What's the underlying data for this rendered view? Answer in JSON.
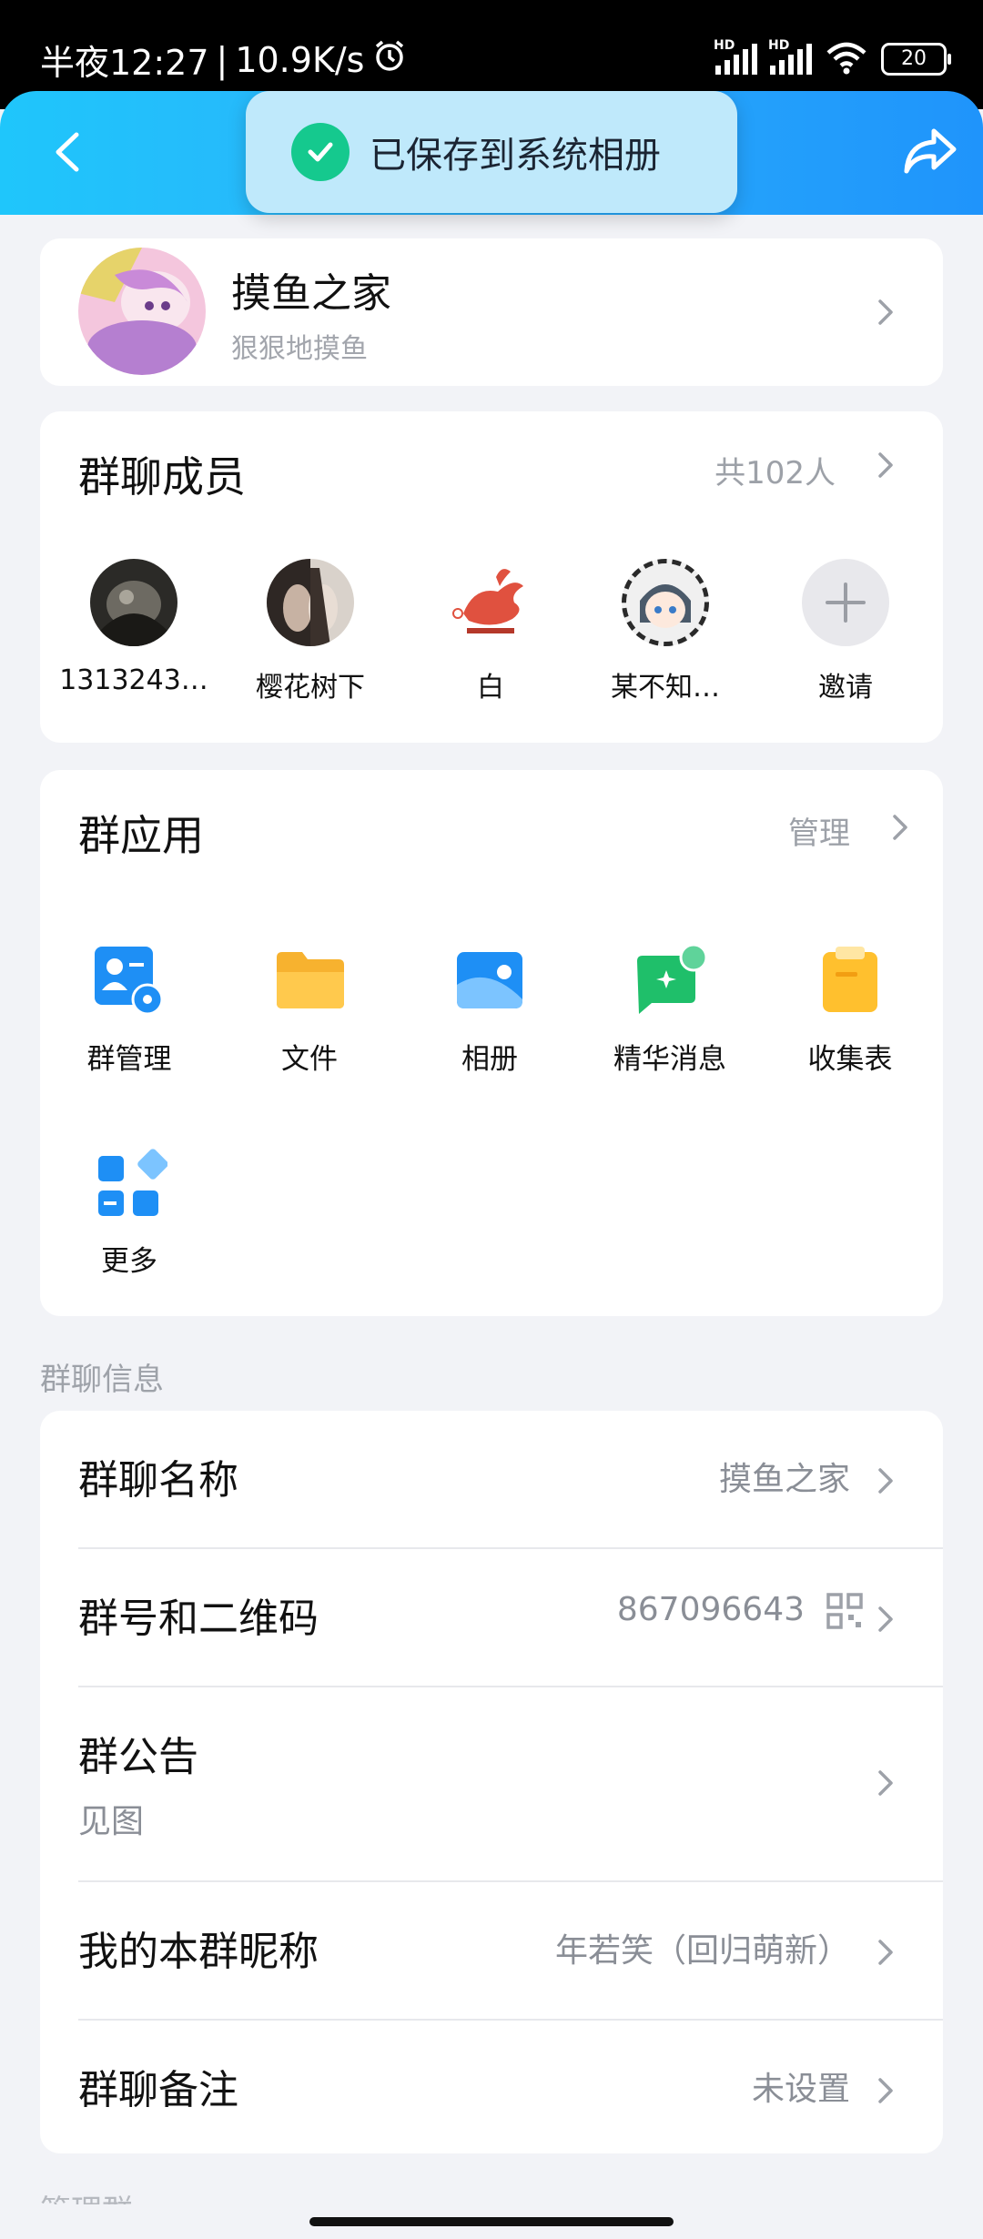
{
  "status_bar": {
    "time": "半夜12:27",
    "separator": "|",
    "speed": "10.9K/s",
    "hd": "HD",
    "battery": "20"
  },
  "toast": {
    "text": "已保存到系统相册"
  },
  "group": {
    "name": "摸鱼之家",
    "subtitle": "狠狠地摸鱼"
  },
  "members": {
    "title": "群聊成员",
    "count": "共102人",
    "list": [
      {
        "name": "1313243…"
      },
      {
        "name": "樱花树下"
      },
      {
        "name": "白"
      },
      {
        "name": "某不知…"
      },
      {
        "name": "邀请"
      }
    ]
  },
  "apps": {
    "title": "群应用",
    "manage": "管理",
    "items": [
      {
        "label": "群管理"
      },
      {
        "label": "文件"
      },
      {
        "label": "相册"
      },
      {
        "label": "精华消息"
      },
      {
        "label": "收集表"
      },
      {
        "label": "更多"
      }
    ]
  },
  "info": {
    "section_label": "群聊信息",
    "rows": [
      {
        "key": "群聊名称",
        "value": "摸鱼之家"
      },
      {
        "key": "群号和二维码",
        "value": "867096643"
      },
      {
        "key": "群公告",
        "value": "见图"
      },
      {
        "key": "我的本群昵称",
        "value": "年若笑（回归萌新）"
      },
      {
        "key": "群聊备注",
        "value": "未设置"
      }
    ]
  },
  "next_section_peek": "管理群",
  "colors": {
    "accent": "#1f94fb",
    "header_start": "#1fc6fb",
    "toast_check": "#15c98e"
  }
}
